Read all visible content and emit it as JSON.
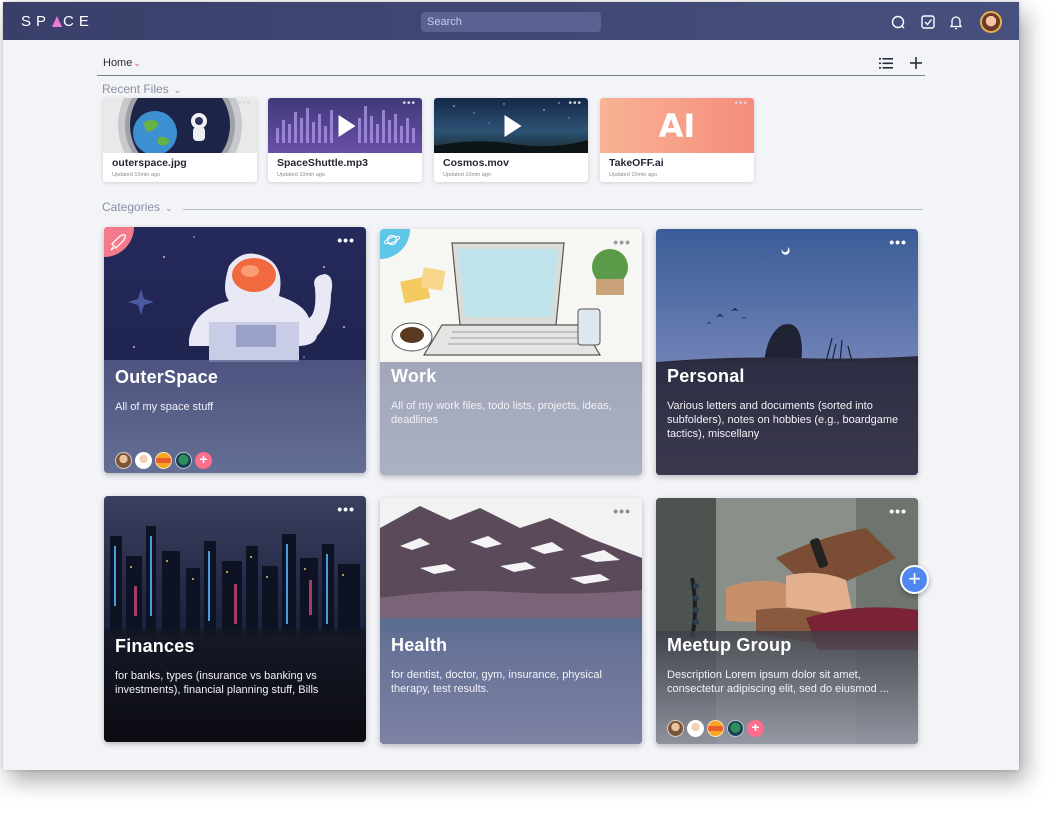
{
  "app": {
    "logo": "SPACE",
    "logo_left": "SP",
    "logo_right": "CE",
    "search_placeholder": "Search",
    "icons": [
      "search-icon",
      "checkbox-icon",
      "bell-icon",
      "avatar"
    ]
  },
  "nav": {
    "home_label": "Home",
    "view_icon": "list-icon",
    "add_icon": "plus-icon"
  },
  "recent": {
    "label": "Recent Files",
    "files": [
      {
        "name": "outerspace.jpg",
        "updated": "Updated 10min ago",
        "kind": "image"
      },
      {
        "name": "SpaceShuttle.mp3",
        "updated": "Updated 10min ago",
        "kind": "audio"
      },
      {
        "name": "Cosmos.mov",
        "updated": "Updated 10min ago",
        "kind": "video"
      },
      {
        "name": "TakeOFF.ai",
        "updated": "Updated 10min ago",
        "kind": "ai",
        "thumb_text": "AI"
      }
    ]
  },
  "categories": {
    "label": "Categories",
    "items": [
      {
        "title": "OuterSpace",
        "description": "All of my space stuff",
        "badge": "rocket-icon",
        "has_avatars": true
      },
      {
        "title": "Work",
        "description": "All of my work files, todo lists, projects, ideas, deadlines",
        "badge": "planet-icon",
        "has_avatars": false
      },
      {
        "title": "Personal",
        "description": "Various letters and documents (sorted into subfolders), notes on hobbies (e.g., boardgame tactics), miscellany",
        "has_avatars": false
      },
      {
        "title": "Finances",
        "description": "for banks, types (insurance vs banking vs investments), financial planning stuff, Bills",
        "has_avatars": false
      },
      {
        "title": "Health",
        "description": "for dentist, doctor, gym, insurance, physical therapy, test results.",
        "has_avatars": false
      },
      {
        "title": "Meetup Group",
        "description": "Description Lorem ipsum dolor sit amet, consectetur adipiscing elit, sed do eiusmod ...",
        "has_avatars": true
      }
    ]
  },
  "colors": {
    "topbar": "#3d4370",
    "accent_pink": "#ff6d8d",
    "fab_blue": "#4f86f0",
    "background": "#f3f4f8"
  }
}
